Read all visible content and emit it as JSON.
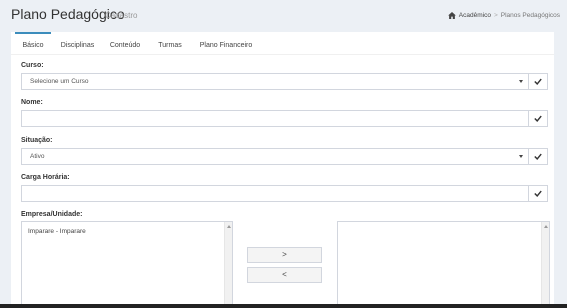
{
  "header": {
    "title": "Plano Pedagógico",
    "subtitle": "Cadastro",
    "breadcrumb": {
      "home_icon": "home-icon",
      "item1": "Acadêmico",
      "separator": ">",
      "item2": "Planos Pedagógicos"
    }
  },
  "tabs": [
    {
      "label": "Básico",
      "active": true
    },
    {
      "label": "Disciplinas",
      "active": false
    },
    {
      "label": "Conteúdo",
      "active": false
    },
    {
      "label": "Turmas",
      "active": false
    },
    {
      "label": "Plano Financeiro",
      "active": false
    }
  ],
  "form": {
    "curso": {
      "label": "Curso:",
      "value": "Selecione um Curso"
    },
    "nome": {
      "label": "Nome:",
      "value": ""
    },
    "situacao": {
      "label": "Situação:",
      "value": "Ativo"
    },
    "carga": {
      "label": "Carga Horária:",
      "value": ""
    },
    "empresa": {
      "label": "Empresa/Unidade:",
      "available": [
        "Imparare - Imparare"
      ],
      "selected": [],
      "add_label": ">",
      "remove_label": "<"
    }
  },
  "colors": {
    "accent": "#3c8dbc",
    "background": "#ecf0f5",
    "border": "#d2d6de"
  },
  "icons": {
    "confirm": "check-icon",
    "dropdown": "chevron-down-icon"
  }
}
